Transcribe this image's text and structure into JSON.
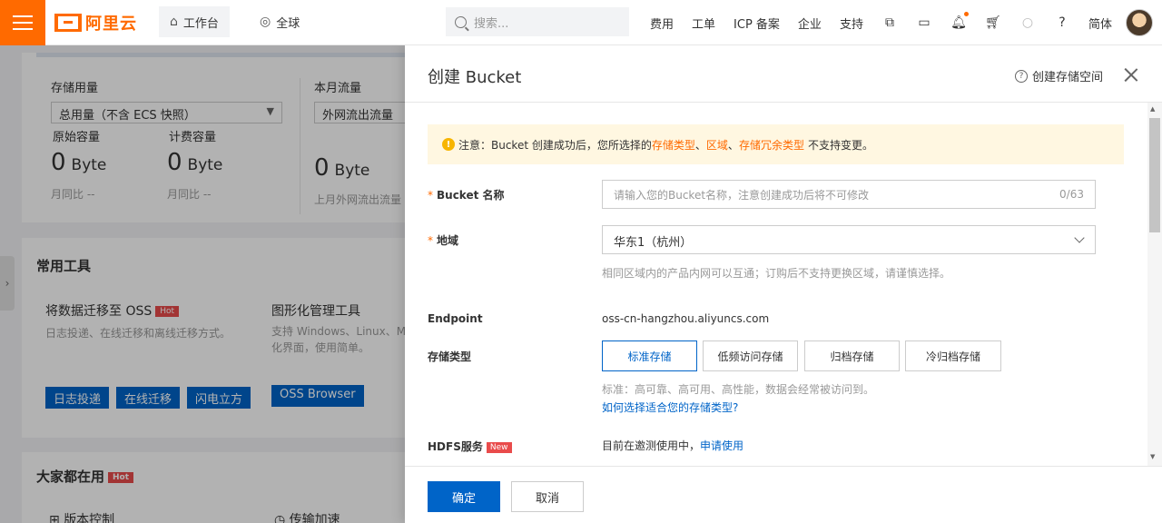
{
  "nav": {
    "logo_text": "阿里云",
    "workbench": "工作台",
    "global": "全球",
    "search_placeholder": "搜索...",
    "links": [
      "费用",
      "工单",
      "ICP 备案",
      "企业",
      "支持"
    ],
    "lang": "简体"
  },
  "dashboard": {
    "storage_usage_label": "存储用量",
    "storage_select": "总用量（不含 ECS 快照）",
    "month_traffic_label": "本月流量",
    "traffic_select": "外网流出流量",
    "original_capacity_label": "原始容量",
    "billing_capacity_label": "计费容量",
    "original_value": "0",
    "billing_value": "0",
    "traffic_value": "0",
    "unit": "Byte",
    "mom1": "月同比 --",
    "mom2": "月同比 --",
    "last_month_traffic": "上月外网流出流量",
    "common_tools_title": "常用工具",
    "tool1_title": "将数据迁移至 OSS",
    "hot": "Hot",
    "tool1_desc": "日志投递、在线迁移和离线迁移方式。",
    "tool1_buttons": [
      "日志投递",
      "在线迁移",
      "闪电立方"
    ],
    "tool2_title": "图形化管理工具",
    "tool2_desc_line1": "支持 Windows、Linux、Ma",
    "tool2_desc_line2": "化界面，使用简单。",
    "tool2_button": "OSS Browser",
    "popular_title": "大家都在用",
    "popular_items": [
      "版本控制",
      "传输加速"
    ]
  },
  "drawer": {
    "title": "创建 Bucket",
    "help_link": "创建存储空间",
    "notice_prefix": "注意：Bucket 创建成功后，您所选择的",
    "notice_t1": "存储类型",
    "notice_sep1": "、",
    "notice_t2": "区域",
    "notice_sep2": "、",
    "notice_t3": "存储冗余类型",
    "notice_suffix": "不支持变更。",
    "bucket_name_label": "Bucket 名称",
    "bucket_name_placeholder": "请输入您的Bucket名称，注意创建成功后将不可修改",
    "bucket_name_counter": "0/63",
    "region_label": "地域",
    "region_value": "华东1（杭州）",
    "region_hint": "相同区域内的产品内网可以互通；订购后不支持更换区域，请谨慎选择。",
    "endpoint_label": "Endpoint",
    "endpoint_value": "oss-cn-hangzhou.aliyuncs.com",
    "storage_type_label": "存储类型",
    "storage_types": [
      "标准存储",
      "低频访问存储",
      "归档存储",
      "冷归档存储"
    ],
    "storage_hint": "标准：高可靠、高可用、高性能，数据会经常被访问到。",
    "storage_help_link": "如何选择适合您的存储类型?",
    "hdfs_label": "HDFS服务",
    "new_badge": "New",
    "hdfs_text": "目前在邀测使用中，",
    "hdfs_link": "申请使用",
    "confirm": "确定",
    "cancel": "取消"
  }
}
